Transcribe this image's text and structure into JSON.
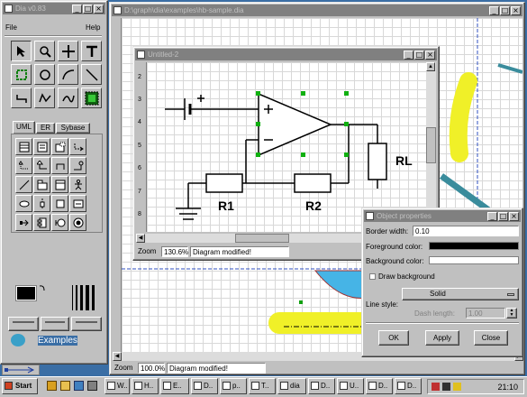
{
  "toolbox": {
    "title": "Dia v0.83",
    "menu": {
      "file": "File",
      "help": "Help"
    },
    "sheet_tabs": [
      "UML",
      "ER",
      "Sybase"
    ],
    "desktop_label": "Examples"
  },
  "main_window": {
    "title": "D:\\graph\\dia\\examples\\hb-sample.dia",
    "zoom_label": "Zoom",
    "zoom_value": "100.0%",
    "status": "Diagram modified!"
  },
  "diagram_window": {
    "title": "Untitled-2",
    "zoom_label": "Zoom",
    "zoom_value": "130.6%",
    "status": "Diagram modified!",
    "ruler_labels": [
      "2",
      "3",
      "4",
      "5",
      "6",
      "7",
      "8"
    ],
    "labels": {
      "r1": "R1",
      "r2": "R2",
      "rl": "RL"
    }
  },
  "properties_dialog": {
    "title": "Object properties",
    "border_width_label": "Border width:",
    "border_width_value": "0.10",
    "foreground_label": "Foreground color:",
    "background_label": "Background color:",
    "draw_background_label": "Draw background",
    "line_style_label": "Line style:",
    "line_style_value": "Solid",
    "dash_length_label": "Dash length:",
    "dash_length_value": "1.00",
    "buttons": {
      "ok": "OK",
      "apply": "Apply",
      "close": "Close"
    }
  },
  "taskbar": {
    "start": "Start",
    "tasks": [
      "W..",
      "H..",
      "E..",
      "D..",
      "p..",
      "T..",
      "dia",
      "D..",
      "U..",
      "D..",
      "D.."
    ],
    "clock": "21:10"
  },
  "colors": {
    "title_active": "#000080",
    "desktop": "#3a6ea5",
    "highlight": "#f0f028",
    "teal": "#3a8c9c",
    "cyan_shape": "#46b4e6"
  }
}
